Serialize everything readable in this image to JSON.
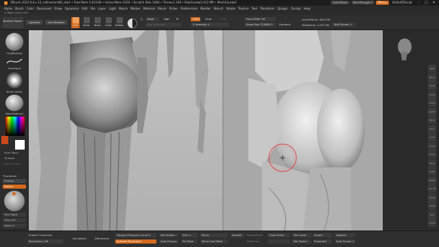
{
  "titlebar": {
    "text": "ZBrush 2022.0.6   ▸ 22_refinement06_start   • Free Mem 2.631GB • Active Mem 3350 • Scratch Disk 1064 • Timer▸1.158 • PolyCount▸2.412 MP • MeshCount▸2",
    "quicksave": "QuickSave",
    "see_through": "See-through  0",
    "menus": "Menus",
    "default_zscript": "DefaultZScript"
  },
  "menubar": {
    "items": [
      "Alpha",
      "Brush",
      "Color",
      "Document",
      "Draw",
      "Dynamics",
      "Edit",
      "File",
      "Layer",
      "Light",
      "Macro",
      "Marker",
      "Material",
      "Movie",
      "Picker",
      "Preferences",
      "Render",
      "Stencil",
      "Stroke",
      "Texture",
      "Tool",
      "Transform",
      "Zplugin",
      "Zscript",
      "Help"
    ]
  },
  "infobar": {
    "text": "0.766,0.159,0.151"
  },
  "shelf": {
    "buttons": {
      "boxtool_master": "BoxTool Master",
      "lightbox": "Lightbox",
      "live_boolean": "Live Boolean",
      "edit": "Edit",
      "draw": "Draw",
      "move": "Move",
      "scale": "Scale",
      "rotate": "Rotate"
    },
    "a_label": "A",
    "mrgb": "Mrgb",
    "rgb": "Rgb",
    "m": "M",
    "rgb_intensity": "Rgb Intensity",
    "zadd": "Zadd",
    "zsub": "Zsub",
    "zcut": "Zcut",
    "z_intensity": "Z Intensity 4",
    "z_intensity_value": 4,
    "focal_shift_label": "Focal Shift",
    "focal_shift_value": "-56",
    "draw_size_label": "Draw Size",
    "draw_size_value": "73.88911",
    "dynamic": "Dynamic",
    "active_points": "ActivePoints: 606,456",
    "total_points": "TotalPoints: 4.353 Mil",
    "split_screen": "Split Screen 1"
  },
  "lefttray": {
    "brush_label": "ClayBuildup",
    "stroke_label": "FreeHand",
    "alpha_label": "Brush Alpha",
    "material_label": "BasicMaterial",
    "from_mesh": "From Mesh",
    "to_mesh": "To Mesh",
    "delete_mesh": "Delete Mesh",
    "thumbnail": "Thumbnail",
    "thumb_on": "Thumb",
    "docker": "Docker",
    "tray_right": "Tray Right",
    "tray_left": "Tray Left",
    "zoom_x": "Zoom X",
    "colors": {
      "accent": "#d36a1e",
      "primary": "#ffffff",
      "secondary": "#000000"
    }
  },
  "righttray": {
    "buttons": [
      "BPR",
      "SPix 3",
      "Scroll",
      "Zoom",
      "Actual",
      "AAHalf",
      "Persp",
      "Floor",
      "Local",
      "L.Sym",
      "Frame",
      "Move",
      "Scale",
      "Rotate",
      "Line Fill",
      "Transp",
      "Ghost",
      "Solo",
      "Xpose"
    ]
  },
  "bottombar": {
    "enable_customize": "Enable Customize",
    "resolution": "Resolution 128",
    "dynamesh": "DynaMesh",
    "zremesher": "ZRemesher",
    "tangent_polygon_count": "Tangent Polygons Count 5",
    "activate_symmetry": "Activate Symmetry",
    "del_hidden": "Del Hidden",
    "auto_groups": "Auto Groups",
    "sdiv": "SDiv 4",
    "fix_mesh": "Fix Mesh",
    "mirror": "Mirror",
    "mirror_and_weld": "Mirror And Weld",
    "smooth": "Smooth",
    "reconstruct": "Reconstruct",
    "close_holes": "Close Holes",
    "shrink_uv": "Shrink Uv",
    "del_lower": "Del Lower",
    "del_higher": "Del Higher",
    "export": "Export",
    "project_all": "ProjectAll",
    "append": "Append",
    "split_screen": "Split Screen 1"
  }
}
